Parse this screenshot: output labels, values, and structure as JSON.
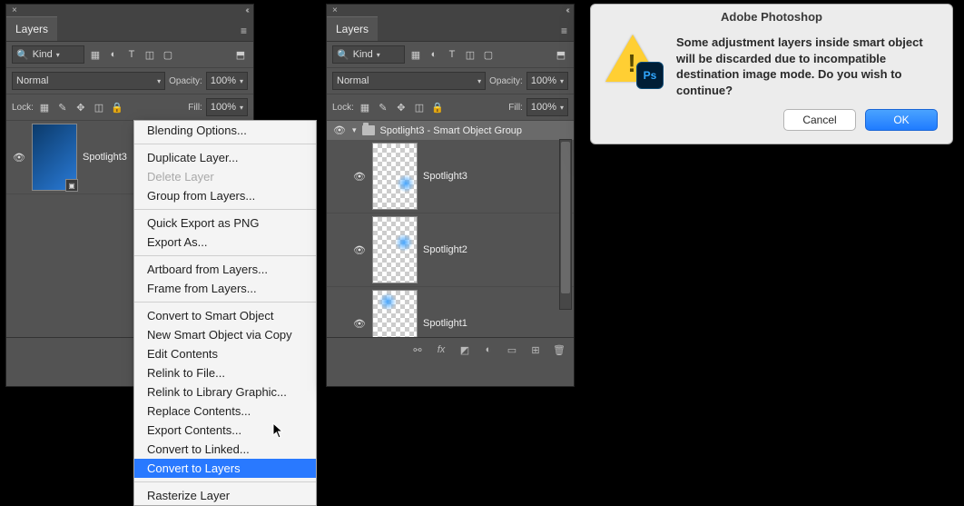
{
  "left_panel": {
    "tab": "Layers",
    "kind_label": "Kind",
    "blend_mode": "Normal",
    "opacity_label": "Opacity:",
    "opacity_value": "100%",
    "lock_label": "Lock:",
    "fill_label": "Fill:",
    "fill_value": "100%",
    "layer": {
      "name": "Spotlight3"
    }
  },
  "context_menu": {
    "items": [
      {
        "label": "Blending Options...",
        "enabled": true
      },
      {
        "sep": true
      },
      {
        "label": "Duplicate Layer...",
        "enabled": true
      },
      {
        "label": "Delete Layer",
        "enabled": false
      },
      {
        "label": "Group from Layers...",
        "enabled": true
      },
      {
        "sep": true
      },
      {
        "label": "Quick Export as PNG",
        "enabled": true
      },
      {
        "label": "Export As...",
        "enabled": true
      },
      {
        "sep": true
      },
      {
        "label": "Artboard from Layers...",
        "enabled": true
      },
      {
        "label": "Frame from Layers...",
        "enabled": true
      },
      {
        "sep": true
      },
      {
        "label": "Convert to Smart Object",
        "enabled": true
      },
      {
        "label": "New Smart Object via Copy",
        "enabled": true
      },
      {
        "label": "Edit Contents",
        "enabled": true
      },
      {
        "label": "Relink to File...",
        "enabled": true
      },
      {
        "label": "Relink to Library Graphic...",
        "enabled": true
      },
      {
        "label": "Replace Contents...",
        "enabled": true
      },
      {
        "label": "Export Contents...",
        "enabled": true
      },
      {
        "label": "Convert to Linked...",
        "enabled": true
      },
      {
        "label": "Convert to Layers",
        "enabled": true,
        "highlight": true
      },
      {
        "sep": true
      },
      {
        "label": "Rasterize Layer",
        "enabled": true
      }
    ]
  },
  "right_panel": {
    "tab": "Layers",
    "kind_label": "Kind",
    "blend_mode": "Normal",
    "opacity_label": "Opacity:",
    "opacity_value": "100%",
    "lock_label": "Lock:",
    "fill_label": "Fill:",
    "fill_value": "100%",
    "group_name": "Spotlight3 - Smart Object Group",
    "layers": [
      {
        "name": "Spotlight3"
      },
      {
        "name": "Spotlight2"
      },
      {
        "name": "Spotlight1"
      }
    ]
  },
  "dialog": {
    "title": "Adobe Photoshop",
    "message": "Some adjustment layers inside smart object will be discarded due to incompatible destination image mode. Do you wish to continue?",
    "ps_label": "Ps",
    "cancel": "Cancel",
    "ok": "OK"
  }
}
